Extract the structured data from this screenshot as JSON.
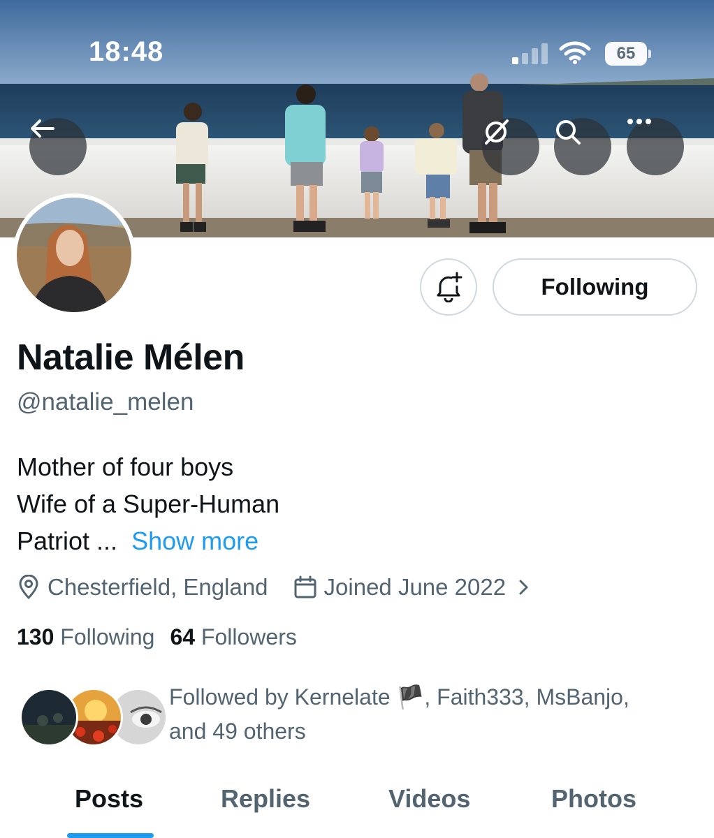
{
  "status_bar": {
    "time": "18:48",
    "battery": "65"
  },
  "banner": {
    "description_icon_back": "arrow-left-icon",
    "icons": [
      "grok-icon",
      "search-icon",
      "more-icon"
    ]
  },
  "actions": {
    "notify_icon": "bell-plus-icon",
    "following_label": "Following"
  },
  "profile": {
    "display_name": "Natalie Mélen",
    "handle": "@natalie_melen",
    "bio_lines": [
      "Mother of four boys",
      "Wife of a Super-Human",
      "Patriot ..."
    ],
    "show_more": "Show more",
    "location": "Chesterfield, England",
    "joined": "Joined June 2022",
    "following_count": "130",
    "following_label": "Following",
    "followers_count": "64",
    "followers_label": "Followers",
    "followed_by": {
      "prefix": "Followed by ",
      "name1": "Kernelate",
      "flag": "🏴",
      "rest_line1": ", Faith333, MsBanjo,",
      "rest_line2": "and 49 others"
    }
  },
  "tabs": [
    {
      "label": "Posts",
      "active": true
    },
    {
      "label": "Replies",
      "active": false
    },
    {
      "label": "Videos",
      "active": false
    },
    {
      "label": "Photos",
      "active": false
    }
  ],
  "colors": {
    "accent": "#1d9bf0",
    "text_primary": "#0f1419",
    "text_secondary": "#536471",
    "border": "#cfd9de"
  }
}
